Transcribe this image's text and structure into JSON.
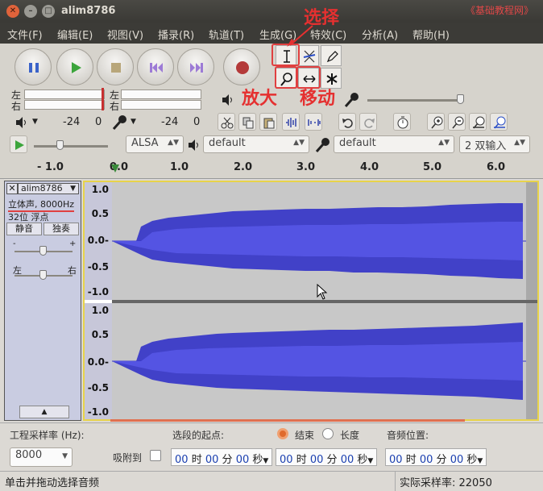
{
  "window": {
    "title": "alim8786",
    "watermark": "《基础教程网》"
  },
  "menu": [
    "文件(F)",
    "编辑(E)",
    "视图(V)",
    "播录(R)",
    "轨道(T)",
    "生成(G)",
    "特效(C)",
    "分析(A)",
    "帮助(H)"
  ],
  "annotations": {
    "select": "选择",
    "zoom": "放大",
    "move": "移动"
  },
  "meters": {
    "left": "左",
    "right": "右",
    "playback_db": "-24",
    "playback_zero": "0",
    "record_db": "-24",
    "record_zero": "0"
  },
  "devices": {
    "host": "ALSA",
    "output": "default",
    "input": "default",
    "channels": "2 双输入"
  },
  "ruler": {
    "ticks": [
      "- 1.0",
      "0.0",
      "1.0",
      "2.0",
      "3.0",
      "4.0",
      "5.0",
      "6.0"
    ]
  },
  "track": {
    "name": "alim8786",
    "info1": "立体声, 8000Hz",
    "info2": "32位 浮点",
    "mute": "静音",
    "solo": "独奏",
    "gain_minus": "-",
    "gain_plus": "+",
    "pan_left": "左",
    "pan_right": "右",
    "scale": [
      "1.0",
      "0.5",
      "0.0-",
      "-0.5",
      "-1.0"
    ]
  },
  "bottom": {
    "rate_label": "工程采样率 (Hz):",
    "rate_value": "8000",
    "snap_label": "吸附到",
    "start_label": "选段的起点:",
    "end_option": "结束",
    "length_option": "长度",
    "pos_label": "音频位置:",
    "time_hours": "00",
    "time_h_unit": "时",
    "time_minutes": "00",
    "time_m_unit": "分",
    "time_seconds": "00",
    "time_s_unit": "秒"
  },
  "status": {
    "hint": "单击并拖动选择音频",
    "actual_rate": "实际采样率:  22050"
  },
  "colors": {
    "waveform": "#3232c8",
    "annotation": "#e53030",
    "selection_border": "#e8d34a"
  }
}
